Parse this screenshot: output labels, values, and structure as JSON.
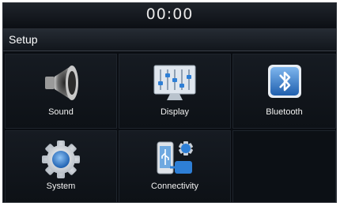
{
  "status_bar": {
    "time": "00:00"
  },
  "header": {
    "title": "Setup"
  },
  "menu": {
    "items": [
      {
        "label": "Sound",
        "icon": "speaker-icon"
      },
      {
        "label": "Display",
        "icon": "display-equalizer-icon"
      },
      {
        "label": "Bluetooth",
        "icon": "bluetooth-icon"
      },
      {
        "label": "System",
        "icon": "gear-icon"
      },
      {
        "label": "Connectivity",
        "icon": "phone-usb-icon"
      }
    ]
  },
  "colors": {
    "background": "#0a0d12",
    "tile": "#161b22",
    "accent_blue": "#2e7fd6",
    "text": "#f2f2f2"
  }
}
